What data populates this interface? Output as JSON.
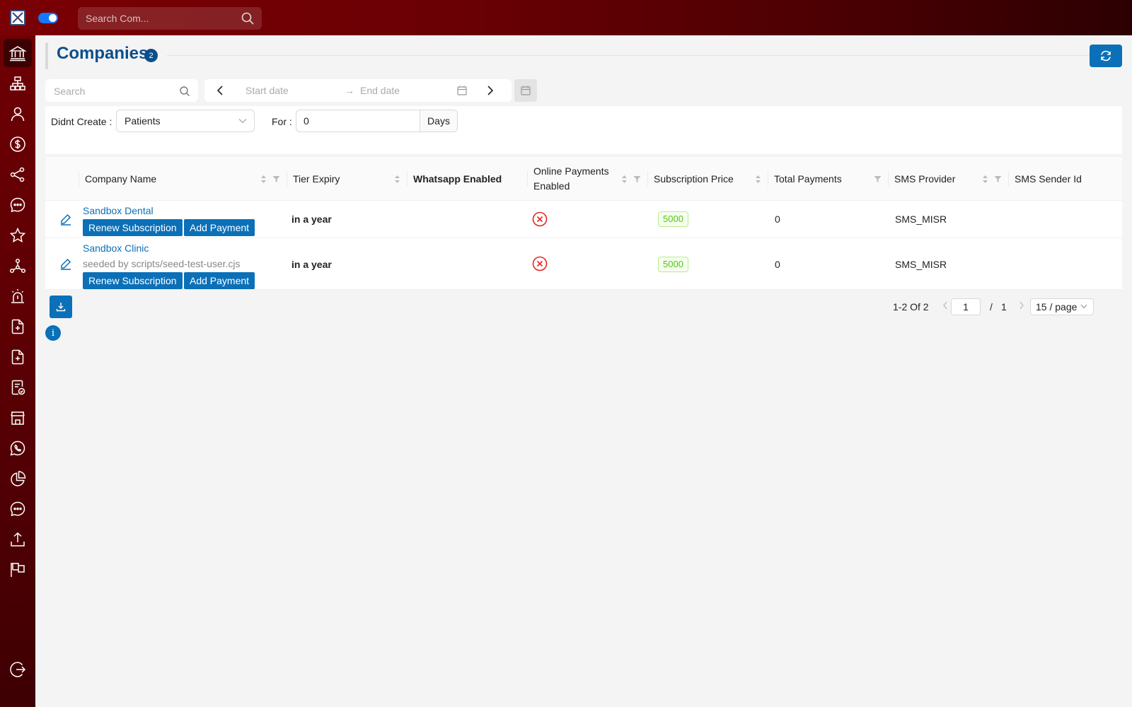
{
  "topbar": {
    "search_placeholder": "Search Com...",
    "toggle_on": true
  },
  "sidebar": {
    "items": [
      {
        "icon": "bank-icon",
        "active": true
      },
      {
        "icon": "org-chart-icon"
      },
      {
        "icon": "user-icon"
      },
      {
        "icon": "dollar-icon"
      },
      {
        "icon": "share-icon"
      },
      {
        "icon": "chat-icon"
      },
      {
        "icon": "star-icon"
      },
      {
        "icon": "network-icon"
      },
      {
        "icon": "alarm-icon"
      },
      {
        "icon": "document-add-icon"
      },
      {
        "icon": "document-edit-icon"
      },
      {
        "icon": "document-check-icon"
      },
      {
        "icon": "store-icon"
      },
      {
        "icon": "whatsapp-icon"
      },
      {
        "icon": "pie-chart-icon"
      },
      {
        "icon": "messages-icon"
      },
      {
        "icon": "upload-icon"
      },
      {
        "icon": "flag-icon"
      },
      {
        "icon": "logout-icon"
      }
    ]
  },
  "header": {
    "title": "Companies",
    "count": "2"
  },
  "filters": {
    "search_placeholder": "Search",
    "start_date_placeholder": "Start date",
    "end_date_placeholder": "End date",
    "arrow": "→",
    "didnt_create_label": "Didnt Create :",
    "didnt_create_value": "Patients",
    "for_label": "For :",
    "for_value": "0",
    "for_unit": "Days"
  },
  "table": {
    "columns": [
      {
        "label": "Company Name"
      },
      {
        "label": "Tier Expiry"
      },
      {
        "label": "Whatsapp Enabled"
      },
      {
        "label": "Online Payments Enabled"
      },
      {
        "label": "Subscription Price"
      },
      {
        "label": "Total Payments"
      },
      {
        "label": "SMS Provider"
      },
      {
        "label": "SMS Sender Id"
      }
    ],
    "rows": [
      {
        "name": "Sandbox Dental",
        "subtitle": "",
        "renew_label": "Renew Subscription",
        "add_payment_label": "Add Payment",
        "tier_expiry": "in a year",
        "online_payments_enabled": false,
        "subscription_price": "5000",
        "total_payments": "0",
        "sms_provider": "SMS_MISR"
      },
      {
        "name": "Sandbox Clinic",
        "subtitle": "seeded by scripts/seed-test-user.cjs",
        "renew_label": "Renew Subscription",
        "add_payment_label": "Add Payment",
        "tier_expiry": "in a year",
        "online_payments_enabled": false,
        "subscription_price": "5000",
        "total_payments": "0",
        "sms_provider": "SMS_MISR"
      }
    ]
  },
  "pagination": {
    "range": "1-2 Of 2",
    "current_page": "1",
    "slash": "/",
    "total_pages": "1",
    "page_size": "15 / page"
  },
  "colors": {
    "brand_primary": "#0b70b8",
    "title_color": "#0b4f8a",
    "topbar_start": "#7a0004",
    "error_red": "#e8231b",
    "price_green": "#52c41a"
  }
}
